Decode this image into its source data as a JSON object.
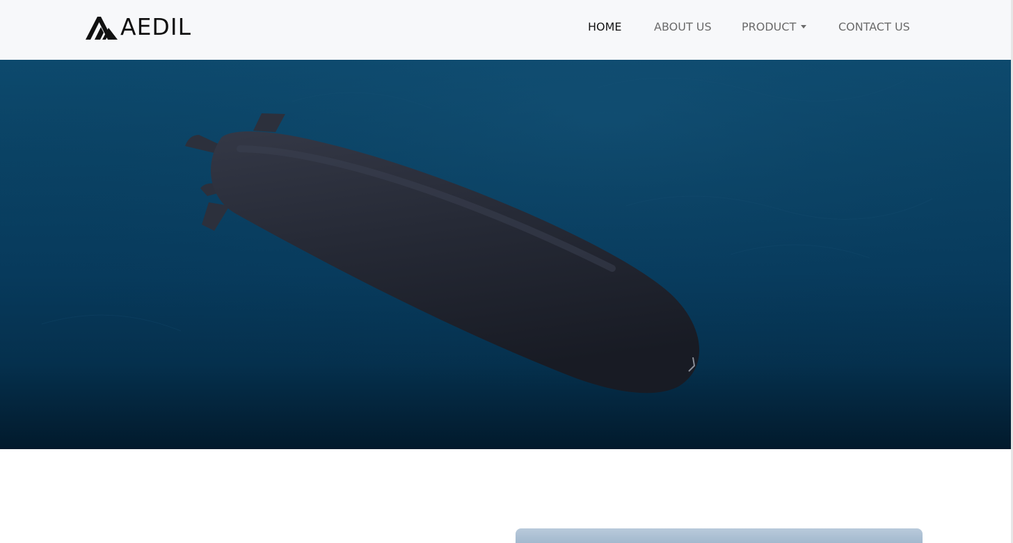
{
  "brand": {
    "name": "AEDIL",
    "logo_icon": "aedil-logo-mark",
    "text_color": "#111111"
  },
  "nav": {
    "items": [
      {
        "label": "HOME",
        "active": true
      },
      {
        "label": "ABOUT US",
        "active": false
      },
      {
        "label": "PRODUCT",
        "active": false,
        "has_dropdown": true
      },
      {
        "label": "CONTACT US",
        "active": false
      }
    ],
    "dropdown_icon": "caret-down-icon",
    "active_color": "#141414",
    "inactive_color": "#6a6a6a",
    "background": "#f7f8fa"
  },
  "hero": {
    "image": "underwater-drone-vehicle",
    "background_top": "#0d4a6e",
    "background_bottom": "#021a2c"
  },
  "content_card": {
    "image": "sky-photo"
  }
}
